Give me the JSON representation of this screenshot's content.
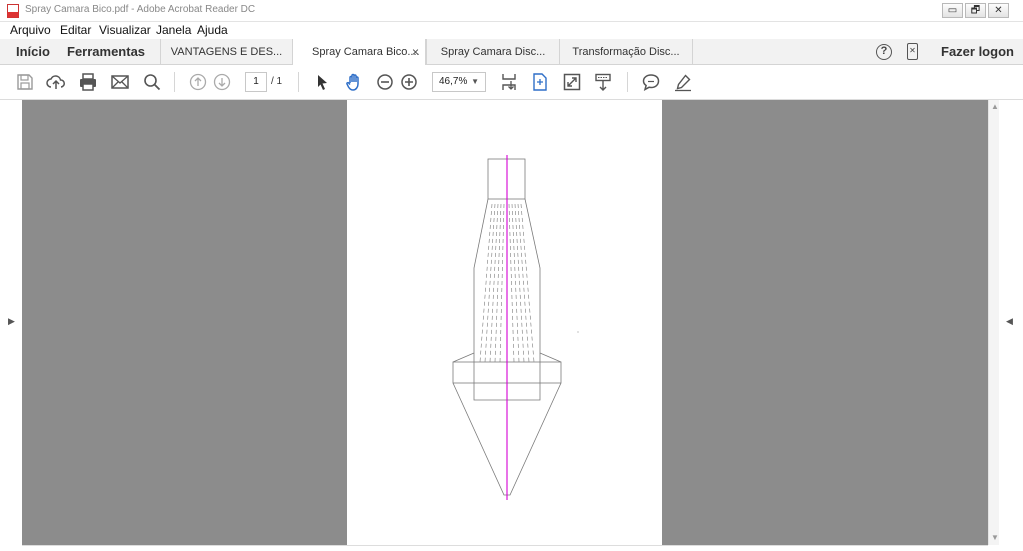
{
  "window": {
    "title": "Spray Camara Bico.pdf - Adobe Acrobat Reader DC",
    "minimize_label": "▭",
    "restore_label": "🗗",
    "close_label": "✕"
  },
  "menu": {
    "items": [
      "Arquivo",
      "Editar",
      "Visualizar",
      "Janela",
      "Ajuda"
    ]
  },
  "tabs": {
    "home": "Início",
    "tools": "Ferramentas",
    "documents": [
      {
        "label": "VANTAGENS E DES...",
        "active": false
      },
      {
        "label": "Spray Camara Bico....",
        "active": true,
        "close": "×"
      },
      {
        "label": "Spray Camara Disc...",
        "active": false
      },
      {
        "label": "Transformação Disc...",
        "active": false
      }
    ],
    "help_icon": "question-circle-icon",
    "mobile_icon": "mobile-link-icon",
    "logon": "Fazer logon"
  },
  "toolbar": {
    "page_current": "1",
    "page_total": "/ 1",
    "zoom": "46,7%",
    "icons": [
      "save-icon",
      "upload-cloud-icon",
      "print-icon",
      "email-icon",
      "search-icon",
      "previous-page-icon",
      "next-page-icon",
      "select-arrow-icon",
      "hand-tool-icon",
      "zoom-out-icon",
      "zoom-in-icon",
      "scroll-mode-icon",
      "fit-page-icon",
      "full-screen-icon",
      "read-mode-icon",
      "comment-icon",
      "highlight-pen-icon"
    ]
  },
  "colors": {
    "accent_active": "#2f6fc8",
    "canvas_gray": "#8c8c8c",
    "drawing_line": "#7a7a7a",
    "axis_line": "#d400d4"
  }
}
